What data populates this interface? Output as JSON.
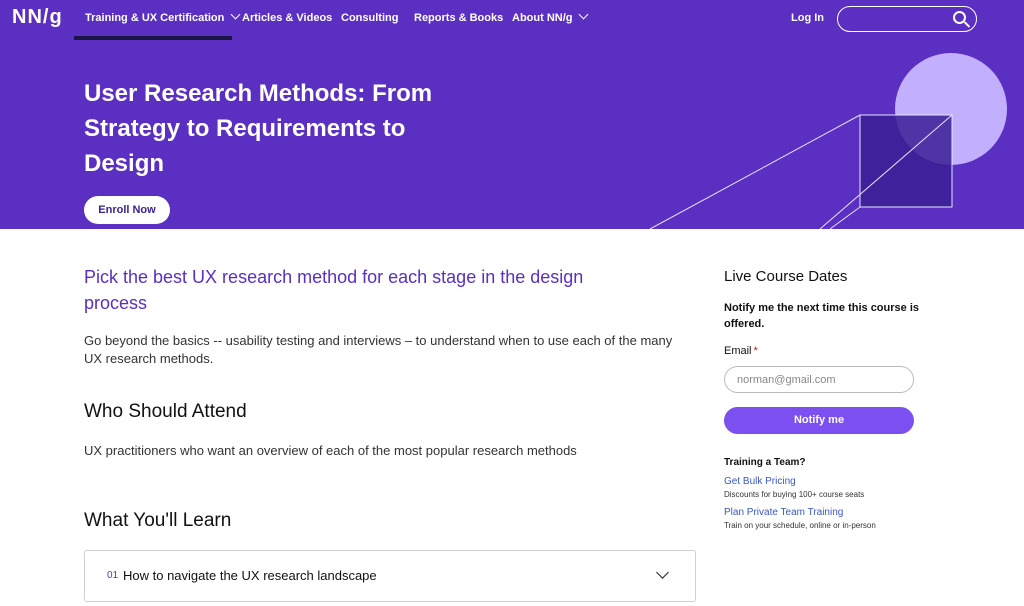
{
  "nav": {
    "logo": "NN/g",
    "items": [
      {
        "label": "Training & UX Certification",
        "has_dropdown": true
      },
      {
        "label": "Articles & Videos",
        "has_dropdown": false
      },
      {
        "label": "Consulting",
        "has_dropdown": false
      },
      {
        "label": "Reports & Books",
        "has_dropdown": false
      },
      {
        "label": "About NN/g",
        "has_dropdown": true
      }
    ],
    "login": "Log In",
    "search_icon": "search-icon"
  },
  "hero": {
    "title": "User Research Methods: From Strategy to Requirements to Design",
    "enroll": "Enroll Now"
  },
  "main": {
    "lead": "Pick the best UX research method for each stage in the design process",
    "intro": "Go beyond the basics -- usability testing and interviews – to understand when to use each of the many UX research methods.",
    "who_heading": "Who Should Attend",
    "who_text": "UX practitioners who want an overview of each of the most popular research methods",
    "learn_heading": "What You'll Learn",
    "accordion": [
      {
        "num": "01",
        "title": "How to navigate the UX research landscape"
      }
    ]
  },
  "sidebar": {
    "heading": "Live Course Dates",
    "notify_text": "Notify me the next time this course is offered.",
    "email_label": "Email",
    "required_mark": "*",
    "email_placeholder": "norman@gmail.com",
    "notify_button": "Notify me",
    "team_heading": "Training a Team?",
    "links": [
      {
        "label": "Get Bulk Pricing",
        "note": "Discounts for buying 100+ course seats"
      },
      {
        "label": "Plan Private Team Training",
        "note": "Train on your schedule, online or in-person"
      }
    ]
  },
  "colors": {
    "brand": "#5a2fc2",
    "button": "#7b4ff0",
    "art_circle": "#c2b0ff",
    "art_square": "#3a1e94"
  }
}
